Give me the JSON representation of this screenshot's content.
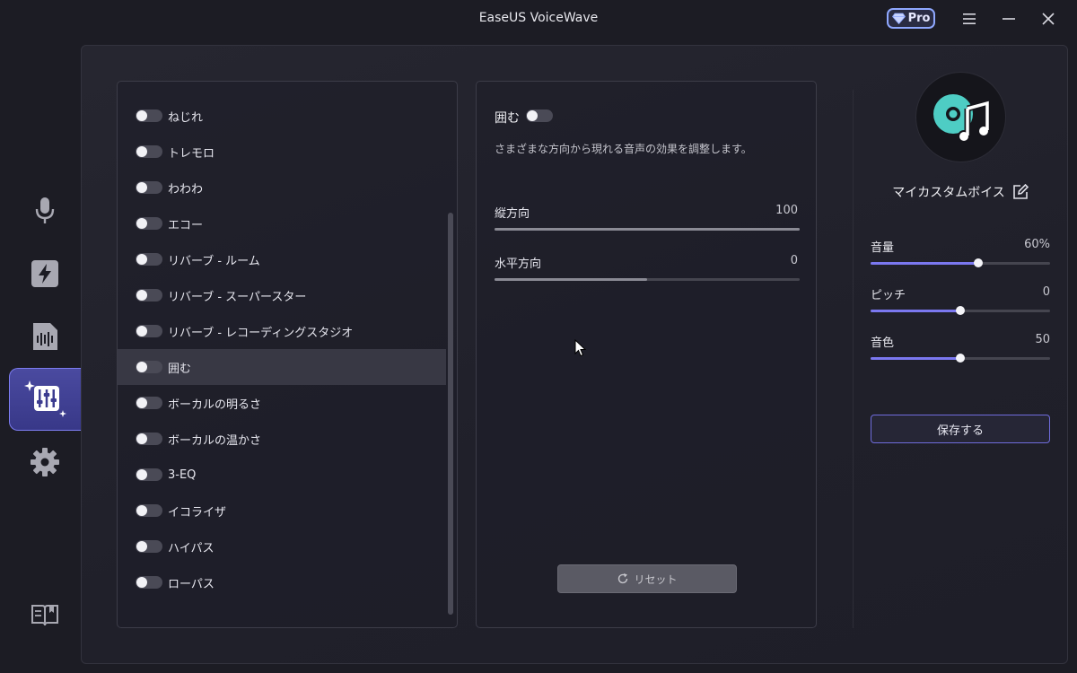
{
  "window": {
    "title": "EaseUS VoiceWave",
    "pro_label": "Pro"
  },
  "sidebar": {
    "items": [
      {
        "name": "microphone",
        "icon": "microphone-icon",
        "active": false
      },
      {
        "name": "quick",
        "icon": "lightning-icon",
        "active": false
      },
      {
        "name": "soundboard",
        "icon": "audio-file-icon",
        "active": false
      },
      {
        "name": "effects",
        "icon": "equalizer-sparkle-icon",
        "active": true
      },
      {
        "name": "settings",
        "icon": "gear-icon",
        "active": false
      },
      {
        "name": "guide",
        "icon": "book-icon",
        "active": false
      }
    ]
  },
  "effects": {
    "items": [
      {
        "label": "ねじれ",
        "on": false
      },
      {
        "label": "トレモロ",
        "on": false
      },
      {
        "label": "わわわ",
        "on": false
      },
      {
        "label": "エコー",
        "on": false
      },
      {
        "label": "リバーブ - ルーム",
        "on": false
      },
      {
        "label": "リバーブ - スーパースター",
        "on": false
      },
      {
        "label": "リバーブ - レコーディングスタジオ",
        "on": false
      },
      {
        "label": "囲む",
        "on": false,
        "selected": true
      },
      {
        "label": "ボーカルの明るさ",
        "on": false
      },
      {
        "label": "ボーカルの温かさ",
        "on": false
      },
      {
        "label": "3-EQ",
        "on": false
      },
      {
        "label": "イコライザ",
        "on": false
      },
      {
        "label": "ハイパス",
        "on": false
      },
      {
        "label": "ローパス",
        "on": false
      }
    ]
  },
  "detail": {
    "title": "囲む",
    "enabled": false,
    "description": "さまざまな方向から現れる音声の効果を調整します。",
    "params": [
      {
        "label": "縦方向",
        "value": "100",
        "fraction": 1.0
      },
      {
        "label": "水平方向",
        "value": "0",
        "fraction": 0.5
      }
    ],
    "reset_label": "リセット"
  },
  "voice": {
    "name": "マイカスタムボイス",
    "controls": [
      {
        "label": "音量",
        "value": "60%",
        "fraction": 0.6
      },
      {
        "label": "ピッチ",
        "value": "0",
        "fraction": 0.5
      },
      {
        "label": "音色",
        "value": "50",
        "fraction": 0.5
      }
    ],
    "save_label": "保存する"
  },
  "colors": {
    "accent": "#7b78f0",
    "avatar_teal": "#4ecdc4"
  }
}
